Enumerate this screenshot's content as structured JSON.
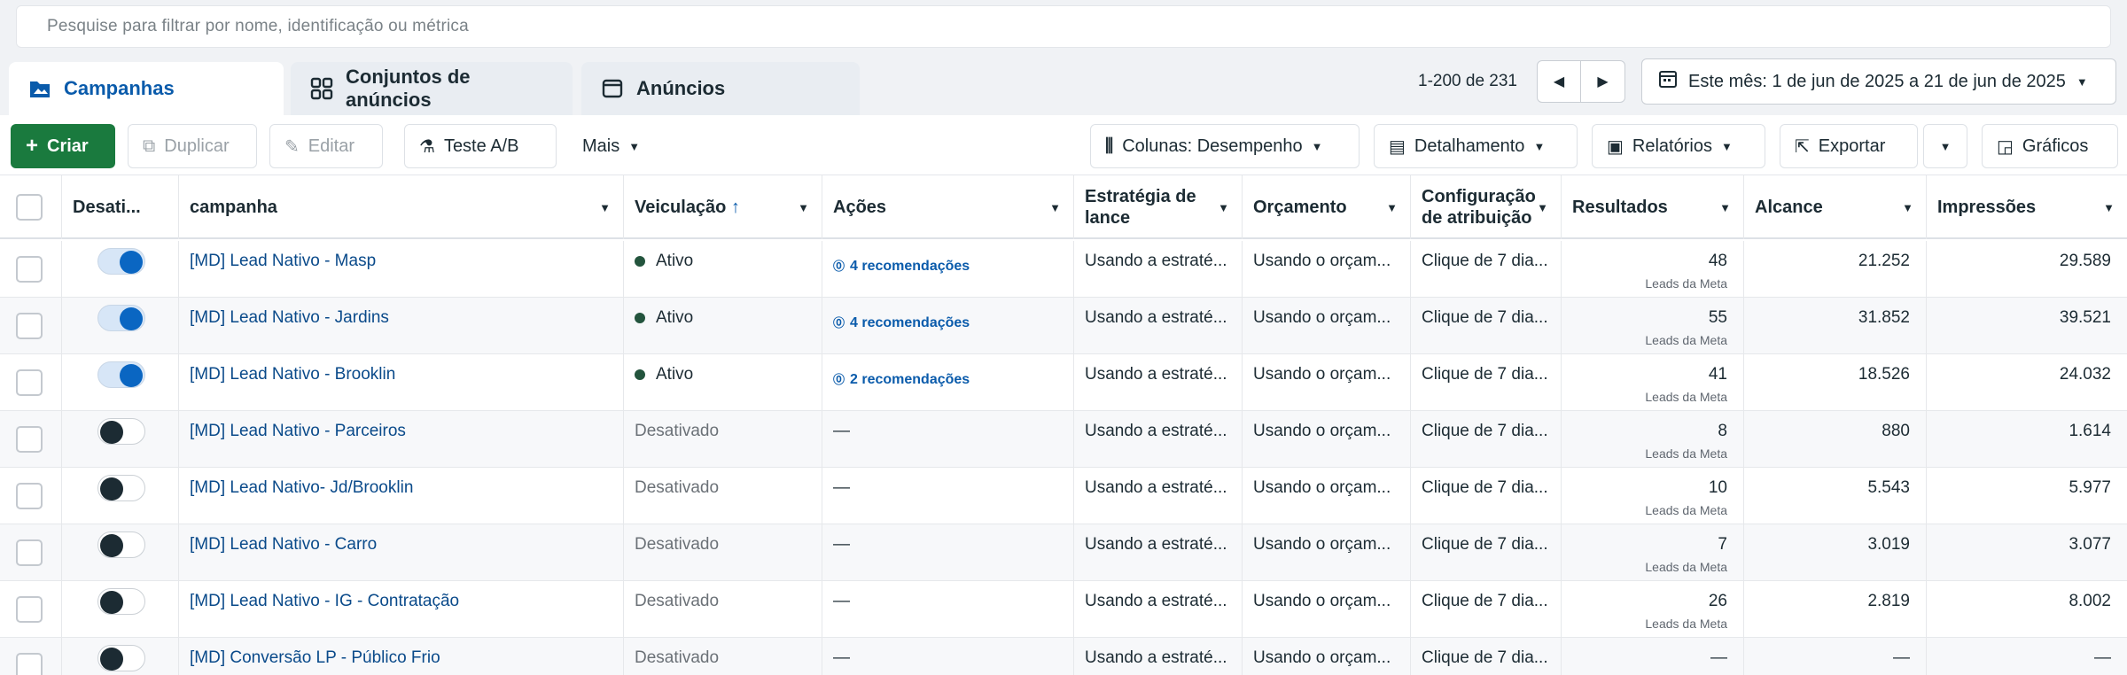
{
  "search": {
    "placeholder": "Pesquise para filtrar por nome, identificação ou métrica"
  },
  "tabs": [
    {
      "label": "Campanhas",
      "icon": "folder-icon"
    },
    {
      "label": "Conjuntos de anúncios",
      "icon": "grid-icon"
    },
    {
      "label": "Anúncios",
      "icon": "ad-icon"
    }
  ],
  "pager": {
    "range": "1-200 de 231",
    "prev": "◀",
    "next": "▶"
  },
  "date": {
    "label": "Este mês: 1 de jun de 2025 a 21 de jun de 2025"
  },
  "toolbar": {
    "create": "Criar",
    "duplicate": "Duplicar",
    "edit": "Editar",
    "abtest": "Teste A/B",
    "more": "Mais",
    "columns": "Colunas: Desempenho",
    "breakdown": "Detalhamento",
    "reports": "Relatórios",
    "export": "Exportar",
    "charts": "Gráficos"
  },
  "table": {
    "headers": {
      "toggle": "Desati...",
      "campaign": "campanha",
      "delivery": "Veiculação",
      "delivery_sort": "↑",
      "actions": "Ações",
      "bid": "Estratégia de lance",
      "budget": "Orçamento",
      "attribution": "Configuração de atribuição",
      "results": "Resultados",
      "reach": "Alcance",
      "impressions": "Impressões"
    },
    "rows": [
      {
        "on": true,
        "campaign": "[MD] Lead Nativo - Masp",
        "delivery": "Ativo",
        "actions": "4 recomendações",
        "bid": "Usando a estraté...",
        "budget": "Usando o orçam...",
        "attribution": "Clique de 7 dia...",
        "results": "48",
        "results_sub": "Leads da Meta",
        "reach": "21.252",
        "impressions": "29.589"
      },
      {
        "on": true,
        "campaign": "[MD] Lead Nativo - Jardins",
        "delivery": "Ativo",
        "actions": "4 recomendações",
        "bid": "Usando a estraté...",
        "budget": "Usando o orçam...",
        "attribution": "Clique de 7 dia...",
        "results": "55",
        "results_sub": "Leads da Meta",
        "reach": "31.852",
        "impressions": "39.521"
      },
      {
        "on": true,
        "campaign": "[MD] Lead Nativo - Brooklin",
        "delivery": "Ativo",
        "actions": "2 recomendações",
        "bid": "Usando a estraté...",
        "budget": "Usando o orçam...",
        "attribution": "Clique de 7 dia...",
        "results": "41",
        "results_sub": "Leads da Meta",
        "reach": "18.526",
        "impressions": "24.032"
      },
      {
        "on": false,
        "campaign": "[MD] Lead Nativo - Parceiros",
        "delivery": "Desativado",
        "actions": "—",
        "bid": "Usando a estraté...",
        "budget": "Usando o orçam...",
        "attribution": "Clique de 7 dia...",
        "results": "8",
        "results_sub": "Leads da Meta",
        "reach": "880",
        "impressions": "1.614"
      },
      {
        "on": false,
        "campaign": "[MD] Lead Nativo- Jd/Brooklin",
        "delivery": "Desativado",
        "actions": "—",
        "bid": "Usando a estraté...",
        "budget": "Usando o orçam...",
        "attribution": "Clique de 7 dia...",
        "results": "10",
        "results_sub": "Leads da Meta",
        "reach": "5.543",
        "impressions": "5.977"
      },
      {
        "on": false,
        "campaign": "[MD] Lead Nativo - Carro",
        "delivery": "Desativado",
        "actions": "—",
        "bid": "Usando a estraté...",
        "budget": "Usando o orçam...",
        "attribution": "Clique de 7 dia...",
        "results": "7",
        "results_sub": "Leads da Meta",
        "reach": "3.019",
        "impressions": "3.077"
      },
      {
        "on": false,
        "campaign": "[MD] Lead Nativo - IG - Contratação",
        "delivery": "Desativado",
        "actions": "—",
        "bid": "Usando a estraté...",
        "budget": "Usando o orçam...",
        "attribution": "Clique de 7 dia...",
        "results": "26",
        "results_sub": "Leads da Meta",
        "reach": "2.819",
        "impressions": "8.002"
      },
      {
        "on": false,
        "campaign": "[MD] Conversão LP - Público Frio",
        "delivery": "Desativado",
        "actions": "—",
        "bid": "Usando a estraté...",
        "budget": "Usando o orçam...",
        "attribution": "Clique de 7 dia...",
        "results": "—",
        "results_sub": "",
        "reach": "—",
        "impressions": "—"
      }
    ]
  }
}
